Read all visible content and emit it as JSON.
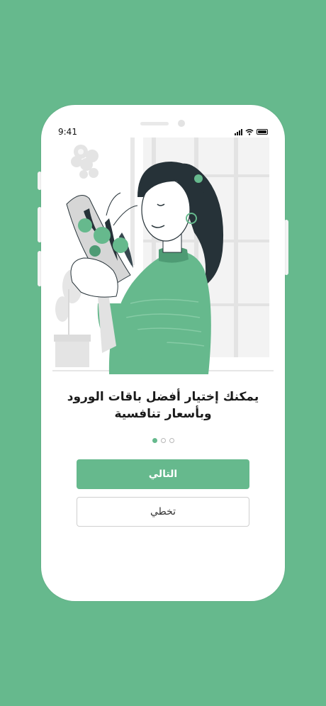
{
  "status_bar": {
    "time": "9:41"
  },
  "onboarding": {
    "headline_line1": "يمكنك إختيار أفضل باقات الورود",
    "headline_line2": "وبأسعار تنافسية",
    "page_indicator": {
      "total": 3,
      "current": 1
    },
    "next_label": "التالي",
    "skip_label": "تخطي"
  },
  "colors": {
    "background": "#66b98d",
    "accent": "#66b98d",
    "hair": "#263238",
    "skin": "#ffffff"
  },
  "icons": [
    "signal-icon",
    "wifi-icon",
    "battery-icon",
    "woman-with-bouquet-illustration"
  ]
}
